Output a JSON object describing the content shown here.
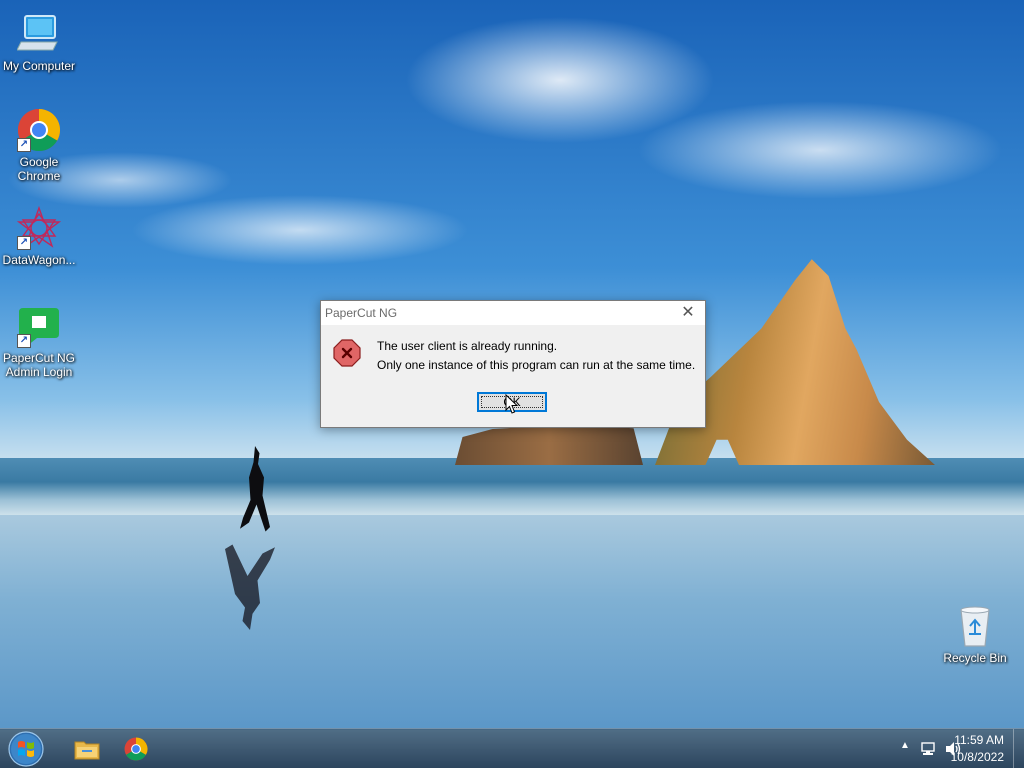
{
  "desktop": {
    "icons": [
      {
        "label": "My Computer",
        "icon": "computer-icon"
      },
      {
        "label": "Google Chrome",
        "icon": "chrome-icon"
      },
      {
        "label": "DataWagon...",
        "icon": "datawagon-icon"
      },
      {
        "label": "PaperCut NG Admin Login",
        "icon": "papercut-icon"
      },
      {
        "label": "Recycle Bin",
        "icon": "recycle-bin-icon"
      }
    ]
  },
  "dialog": {
    "title": "PaperCut NG",
    "close_glyph": "✕",
    "message_line1": "The user client is already running.",
    "message_line2": "Only one instance of this program can run at the same time.",
    "ok_label": "OK",
    "icon": "error-icon"
  },
  "taskbar": {
    "start_icon": "windows-start-icon",
    "pinned": [
      {
        "name": "File Explorer",
        "icon": "folder-icon"
      },
      {
        "name": "Google Chrome",
        "icon": "chrome-icon"
      }
    ],
    "tray": {
      "chevron": "▲",
      "time": "11:59 AM",
      "date": "10/8/2022"
    }
  },
  "colors": {
    "accent": "#0078d7",
    "error_red": "#d9534f"
  }
}
